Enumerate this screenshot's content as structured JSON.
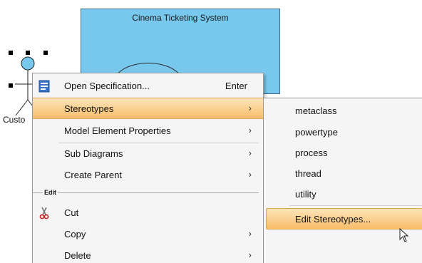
{
  "diagram": {
    "system_title": "Cinema Ticketing System",
    "actor_label": "Custo"
  },
  "context_menu": {
    "items": [
      {
        "label": "Open Specification...",
        "shortcut": "Enter",
        "icon": "specification-icon"
      },
      {
        "label": "Stereotypes",
        "submenu": true,
        "selected": true
      },
      {
        "label": "Model Element Properties",
        "submenu": true
      },
      {
        "label": "Sub Diagrams",
        "submenu": true
      },
      {
        "label": "Create Parent",
        "submenu": true
      },
      {
        "label": "Cut",
        "icon": "scissors-icon"
      },
      {
        "label": "Copy",
        "submenu": true
      },
      {
        "label": "Delete",
        "submenu": true
      }
    ],
    "group_label": "Edit",
    "submenu_arrow": "›"
  },
  "stereotypes_submenu": {
    "items": [
      {
        "label": "metaclass"
      },
      {
        "label": "powertype"
      },
      {
        "label": "process"
      },
      {
        "label": "thread"
      },
      {
        "label": "utility"
      },
      {
        "label": "Edit Stereotypes...",
        "highlighted": true
      }
    ]
  },
  "colors": {
    "system_fill": "#78c8ee",
    "actor_head": "#78c8ee",
    "menu_background": "#f5f5f5",
    "selection_highlight": "#f8bd6c"
  }
}
